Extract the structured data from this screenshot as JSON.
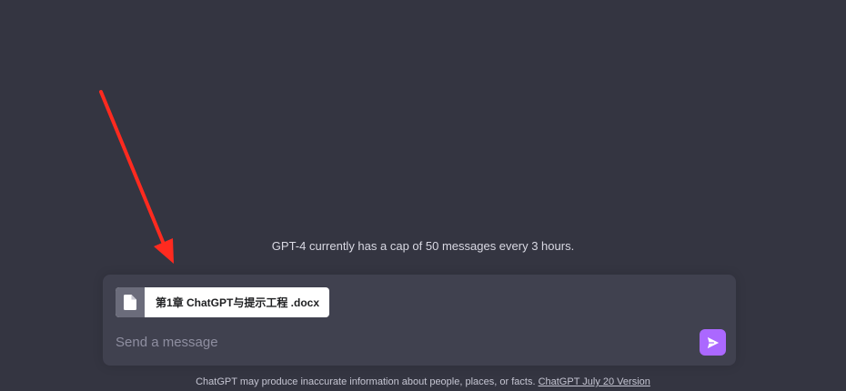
{
  "notice": {
    "cap_text": "GPT-4 currently has a cap of 50 messages every 3 hours."
  },
  "composer": {
    "attachment": {
      "icon": "document-icon",
      "file_name": "第1章 ChatGPT与提示工程 .docx"
    },
    "input": {
      "placeholder": "Send a message",
      "value": ""
    },
    "send_button": {
      "icon": "send-icon",
      "color": "#ab68ff"
    }
  },
  "footer": {
    "disclaimer": "ChatGPT may produce inaccurate information about people, places, or facts.",
    "version_link": "ChatGPT July 20 Version"
  },
  "annotation": {
    "arrow_color": "#ff2a1f"
  },
  "colors": {
    "background": "#343541",
    "composer": "#40414f",
    "accent": "#ab68ff"
  }
}
